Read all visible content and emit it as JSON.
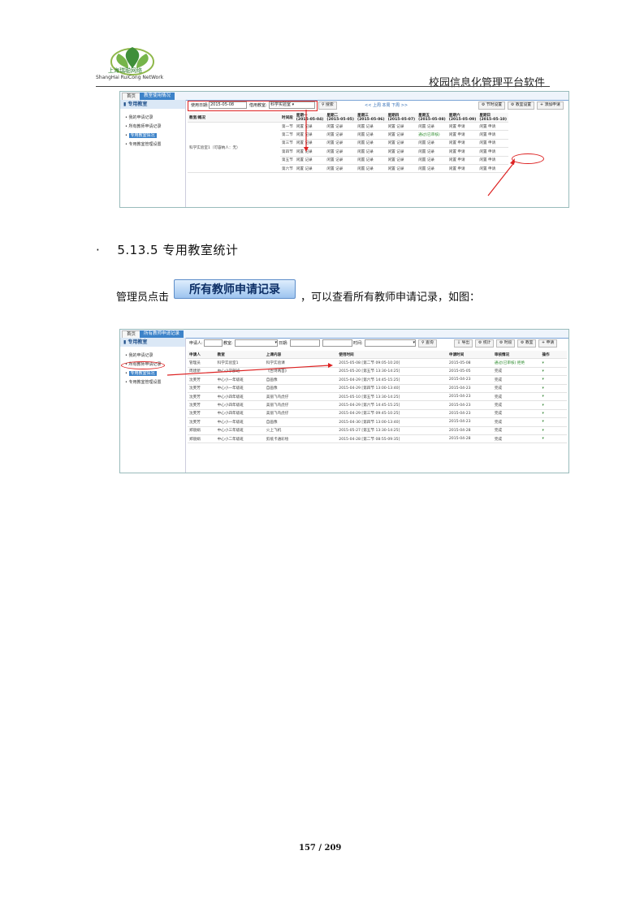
{
  "header": {
    "logo_cn": "上海瑞聪网络",
    "logo_en": "ShangHai RuiCong NetWork",
    "title": "校园信息化管理平台软件"
  },
  "shot1": {
    "tabs": [
      "首页",
      "教室使用情况"
    ],
    "sidebar_title": "专用教室",
    "sidebar_items": [
      "我的申请记录",
      "所有教师申请记录",
      "专用教室情况",
      "专用教室管理设置"
    ],
    "query_date_label": "使用日期:",
    "query_date": "2015-05-08",
    "room_label": "借用教室:",
    "room_value": "科学实验室",
    "search": "搜索",
    "week_nav": "<< 上周 本周 下周 >>",
    "buttons": [
      "节时设置",
      "教室设置",
      "添加申请"
    ],
    "col_room": "教室/概况",
    "col_period": "时间段",
    "days": [
      {
        "name": "星期一",
        "date": "(2015-05-04)"
      },
      {
        "name": "星期二",
        "date": "(2015-05-05)"
      },
      {
        "name": "星期三",
        "date": "(2015-05-06)"
      },
      {
        "name": "星期四",
        "date": "(2015-05-07)"
      },
      {
        "name": "星期五",
        "date": "(2015-05-08)"
      },
      {
        "name": "星期六",
        "date": "(2015-05-09)"
      },
      {
        "name": "星期日",
        "date": "(2015-05-10)"
      }
    ],
    "room_name": "科学实验室1（可容纳人：无）",
    "periods": [
      "第一节",
      "第二节",
      "第三节",
      "第四节",
      "第五节",
      "第六节"
    ],
    "cell_text": "闲置 记录",
    "cell_text_apply": "闲置 申请",
    "highlight_cell": "通过(已审核)"
  },
  "section": {
    "number": "5.13.5",
    "title": "专用教室统计"
  },
  "para": {
    "before": "管理员点击",
    "button": "所有教师申请记录",
    "after": "，可以查看所有教师申请记录，如图："
  },
  "shot2": {
    "tabs": [
      "首页",
      "所有教师申请记录"
    ],
    "sidebar_title": "专用教室",
    "sidebar_items": [
      "我的申请记录",
      "所有教师申请记录",
      "专用教室情况",
      "专用教室管理设置"
    ],
    "filter_applicant": "申请人:",
    "filter_room": "教室:",
    "filter_date": "日期:",
    "filter_period": "时间:",
    "search": "查询",
    "buttons": [
      "导出",
      "统计",
      "时段",
      "教室",
      "申请"
    ],
    "columns": [
      "申请人",
      "教室",
      "上课内容",
      "使用时间",
      "申请时间",
      "审核情况",
      "操作"
    ],
    "rows": [
      [
        "管理员",
        "科学实验室1",
        "科学实验课",
        "2015-05-08 [第二节 09:05-10:20]",
        "2015-05-08",
        "通过(已审核) 拒绝"
      ],
      [
        "周建新",
        "中心小学部班",
        "《古诗两首》",
        "2015-05-20 [第五节 13:30-14:25]",
        "2015-05-05",
        "完成"
      ],
      [
        "沈芙芳",
        "中心小一年级班",
        "自画像",
        "2015-04-29 [第六节 14:45-15:25]",
        "2015-04-23",
        "完成"
      ],
      [
        "沈芙芳",
        "中心小一年级班",
        "自画像",
        "2015-04-29 [第四节 13:00-13:40]",
        "2015-04-23",
        "完成"
      ],
      [
        "沈芙芳",
        "中心小四年级班",
        "美丽飞鸟虎仔",
        "2015-05-10 [第五节 13:30-14:25]",
        "2015-04-23",
        "完成"
      ],
      [
        "沈芙芳",
        "中心小四年级班",
        "美丽飞鸟虎仔",
        "2015-04-29 [第六节 14:45-15:25]",
        "2015-04-23",
        "完成"
      ],
      [
        "沈芙芳",
        "中心小四年级班",
        "美丽飞鸟虎仔",
        "2015-04-29 [第三节 09:45-10:25]",
        "2015-04-23",
        "完成"
      ],
      [
        "沈芙芳",
        "中心小一年级班",
        "自画像",
        "2015-04-30 [第四节 13:00-13:40]",
        "2015-04-23",
        "完成"
      ],
      [
        "郑丽娟",
        "中心小三年级班",
        "火上飞机",
        "2015-05-27 [第五节 13:30-14:25]",
        "2015-04-28",
        "完成"
      ],
      [
        "郑丽娟",
        "中心小二年级班",
        "剪纸卡通彩绘",
        "2015-04-28 [第二节 08:55-09:35]",
        "2015-04-28",
        "完成"
      ]
    ]
  },
  "footer": {
    "page": "157 / 209"
  }
}
